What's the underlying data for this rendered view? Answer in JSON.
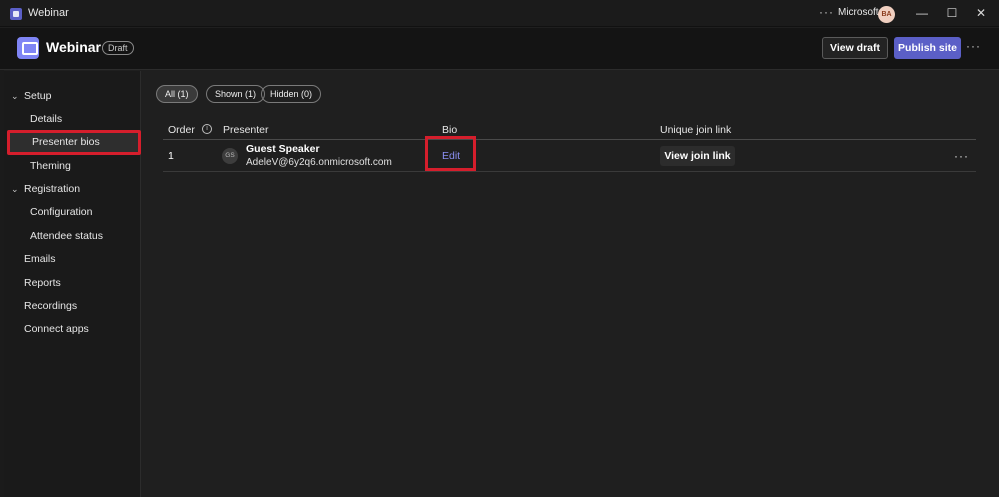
{
  "window": {
    "title": "Webinar",
    "org": "Microsoft",
    "user_initials": "BA",
    "more_icon": "···",
    "minimize_icon": "—",
    "maximize_icon": "☐",
    "close_icon": "✕"
  },
  "header": {
    "title": "Webinar",
    "status_badge": "Draft",
    "view_draft_label": "View draft",
    "publish_label": "Publish site",
    "more_icon": "···"
  },
  "sidebar": {
    "items": [
      {
        "label": "Setup",
        "kind": "section"
      },
      {
        "label": "Details",
        "kind": "sub"
      },
      {
        "label": "Presenter bios",
        "kind": "sub",
        "selected": true
      },
      {
        "label": "Theming",
        "kind": "sub"
      },
      {
        "label": "Registration",
        "kind": "section"
      },
      {
        "label": "Configuration",
        "kind": "sub"
      },
      {
        "label": "Attendee status",
        "kind": "sub"
      },
      {
        "label": "Emails",
        "kind": "top"
      },
      {
        "label": "Reports",
        "kind": "top"
      },
      {
        "label": "Recordings",
        "kind": "top"
      },
      {
        "label": "Connect apps",
        "kind": "top"
      }
    ],
    "chevron_icon": "⌄"
  },
  "filters": [
    {
      "label": "All (1)",
      "active": true
    },
    {
      "label": "Shown (1)",
      "active": false
    },
    {
      "label": "Hidden (0)",
      "active": false
    }
  ],
  "table": {
    "headers": [
      "Order",
      "Presenter",
      "Bio",
      "Unique join link"
    ],
    "info_icon": "i",
    "rows": [
      {
        "order": "1",
        "initials": "GS",
        "name": "Guest Speaker",
        "email": "AdeleV@6y2q6.onmicrosoft.com",
        "bio_action": "Edit",
        "join_action": "View join link",
        "more_icon": "···"
      }
    ]
  },
  "colors": {
    "accent": "#5b5fc7",
    "link": "#8b8ff2",
    "highlight": "#d51e2c",
    "background": "#1f1f1f"
  }
}
